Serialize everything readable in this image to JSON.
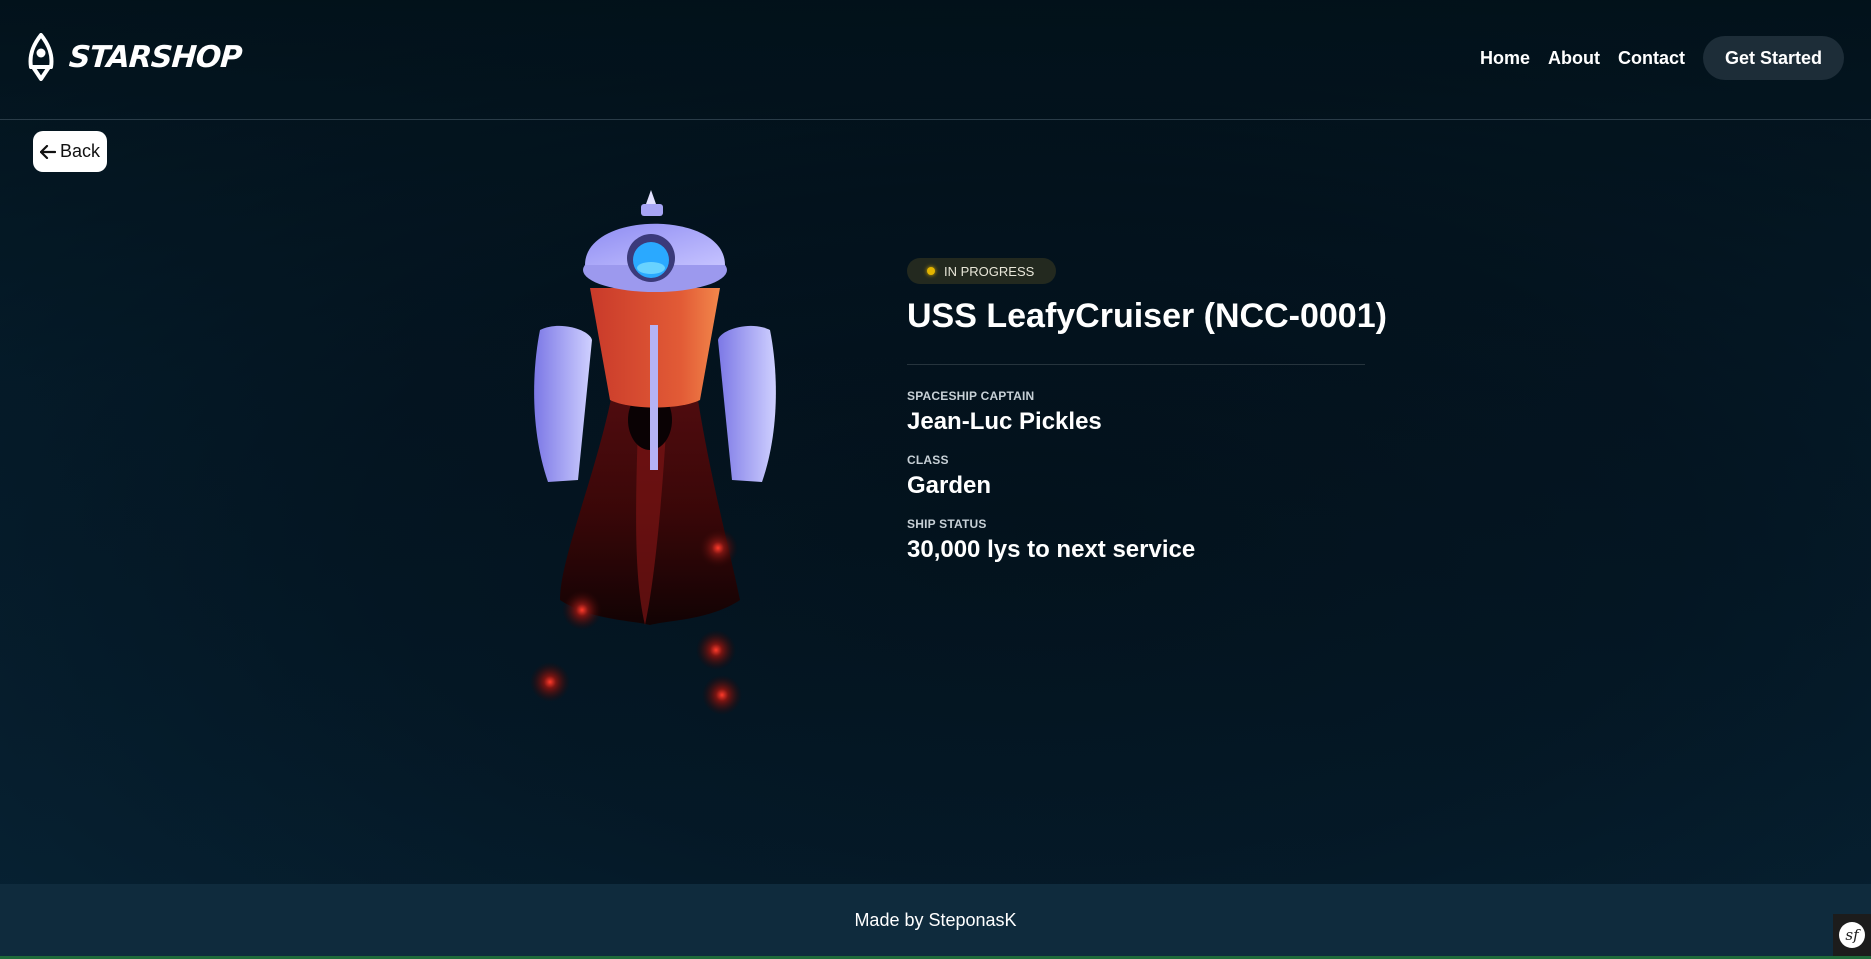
{
  "brand": {
    "name": "STARSHOP",
    "logo_icon": "rocket-icon"
  },
  "nav": {
    "links": [
      "Home",
      "About",
      "Contact"
    ],
    "cta": "Get Started"
  },
  "back_button": {
    "label": "Back",
    "icon": "arrow-left-icon"
  },
  "ship": {
    "status_badge": "IN PROGRESS",
    "status_color": "#e3b400",
    "title": "USS LeafyCruiser (NCC-0001)",
    "fields": [
      {
        "label": "SPACESHIP CAPTAIN",
        "value": "Jean-Luc Pickles"
      },
      {
        "label": "CLASS",
        "value": "Garden"
      },
      {
        "label": "SHIP STATUS",
        "value": "30,000 lys to next service"
      }
    ]
  },
  "footer": {
    "text": "Made by SteponasK"
  },
  "debug_toolbar": {
    "icon": "symfony-icon",
    "glyph": "sf"
  },
  "colors": {
    "background": "#041522",
    "footer_bg": "#0f2b3d",
    "cta_bg": "#1d2d38",
    "badge_bg": "#23291f"
  }
}
